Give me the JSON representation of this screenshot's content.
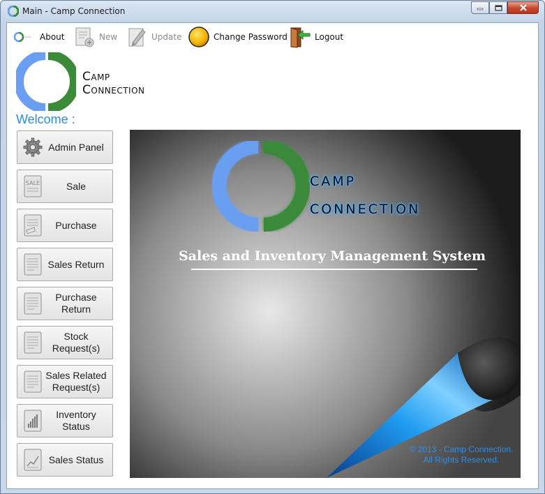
{
  "window": {
    "title": "Main - Camp Connection"
  },
  "toolbar": {
    "items": [
      {
        "label": "About",
        "icon": "about-icon",
        "enabled": true
      },
      {
        "label": "New",
        "icon": "new-document-icon",
        "enabled": false
      },
      {
        "label": "Update",
        "icon": "update-pencil-icon",
        "enabled": false
      },
      {
        "label": "Change Password",
        "icon": "yellow-circle-icon",
        "enabled": true
      },
      {
        "label": "Logout",
        "icon": "door-exit-icon",
        "enabled": true
      }
    ]
  },
  "brand": {
    "line1": "Camp",
    "line2": "Connection",
    "colors": {
      "blue": "#6a9ef0",
      "green": "#3a8a3a"
    }
  },
  "welcome": "Welcome :",
  "nav": [
    {
      "label": "Admin Panel",
      "icon": "gear-icon"
    },
    {
      "label": "Sale",
      "icon": "sale-document-icon"
    },
    {
      "label": "Purchase",
      "icon": "purchase-document-icon"
    },
    {
      "label": "Sales Return",
      "icon": "document-icon"
    },
    {
      "label": "Purchase Return",
      "icon": "document-icon"
    },
    {
      "label": "Stock Request(s)",
      "icon": "document-icon"
    },
    {
      "label": "Sales Related Request(s)",
      "icon": "document-icon"
    },
    {
      "label": "Inventory Status",
      "icon": "bar-chart-document-icon"
    },
    {
      "label": "Sales Status",
      "icon": "chart-document-icon"
    }
  ],
  "splash": {
    "logo_line1": "CAMP",
    "logo_line2": "CONNECTION",
    "system_title": "Sales and Inventory Management System",
    "copyright_line1": "© 2013 - Camp Connection.",
    "copyright_line2": "All Rights Reserved."
  }
}
